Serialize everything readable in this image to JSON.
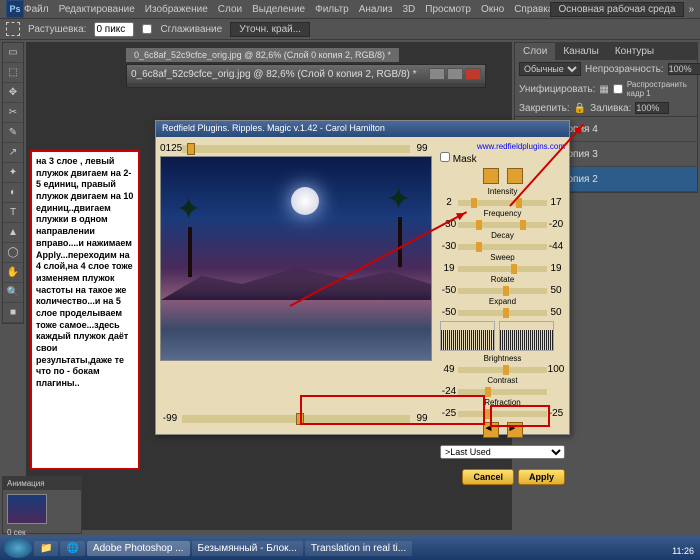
{
  "app": {
    "logo": "Ps"
  },
  "menu": [
    "Файл",
    "Редактирование",
    "Изображение",
    "Слои",
    "Выделение",
    "Фильтр",
    "Анализ",
    "3D",
    "Просмотр",
    "Окно",
    "Справка"
  ],
  "workspace": {
    "label": "Основная рабочая среда"
  },
  "optbar": {
    "rast": "Растушевка:",
    "rast_val": "0 пикс",
    "smooth": "Сглаживание",
    "refine": "Уточн. край..."
  },
  "doc": {
    "tab": "0_6c8af_52c9cfce_orig.jpg @ 82,6% (Слой 0 копия 2, RGB/8) *"
  },
  "panels": {
    "tabs": [
      "Слои",
      "Каналы",
      "Контуры"
    ],
    "mode": "Обычные",
    "opacity_lbl": "Непрозрачность:",
    "opacity": "100%",
    "unify": "Унифицировать:",
    "propagate": "Распространить кадр 1",
    "lock": "Закрепить:",
    "fill_lbl": "Заливка:",
    "fill": "100%",
    "layers": [
      "копия 4",
      "копия 3",
      "копия 2"
    ]
  },
  "plugin": {
    "title": "Redfield Plugins. Ripples. Magic v.1.42 - Carol Hamilton",
    "link": "www.redfieldplugins.com",
    "mask": "Mask",
    "top": {
      "left": "0125",
      "right": "99"
    },
    "labels": {
      "intensity": "Intensity",
      "frequency": "Frequency",
      "decay": "Decay",
      "sweep": "Sweep",
      "rotate": "Rotate",
      "expand": "Expand",
      "brightness": "Brightness",
      "contrast": "Contrast",
      "refraction": "Refraction"
    },
    "vals": {
      "intensity": [
        "2",
        "17"
      ],
      "frequency": [
        "-30",
        "-20"
      ],
      "decay": [
        "-30",
        "-44"
      ],
      "sweep": [
        "19",
        "19"
      ],
      "rotate": [
        "-50",
        "50"
      ],
      "expand": [
        "-50",
        "50"
      ],
      "brightness": [
        "49",
        "100"
      ],
      "contrast": [
        "-24"
      ],
      "refraction": [
        "-25",
        "-25"
      ],
      "bottom": [
        "-99",
        "99"
      ]
    },
    "preset": ">Last Used",
    "cancel": "Cancel",
    "apply": "Apply"
  },
  "note": "на 3 слое , левый плужок двигаем на 2-5 единиц, правый плужок двигаем на 10 единиц..двигаем плужки в одном направлении вправо....и нажимаем Apply...переходим на 4 слой,на 4 слое тоже изменяем плужок частоты на такое же количество...и на 5 слое проделываем тоже самое...здесь каждый плужок даёт свои результаты,даже те что по - бокам плагины..",
  "bottom_panel": {
    "tab": "Анимация",
    "frame": "0 сек"
  },
  "taskbar": {
    "items": [
      "Adobe Photoshop ...",
      "Безымянный - Блок...",
      "Translation in real ti..."
    ],
    "time": "11:26"
  },
  "tools": [
    "▭",
    "⬚",
    "✥",
    "✂",
    "✎",
    "↗",
    "✦",
    "◐",
    "T",
    "▲",
    "◯",
    "✋",
    "🔍",
    "■"
  ]
}
